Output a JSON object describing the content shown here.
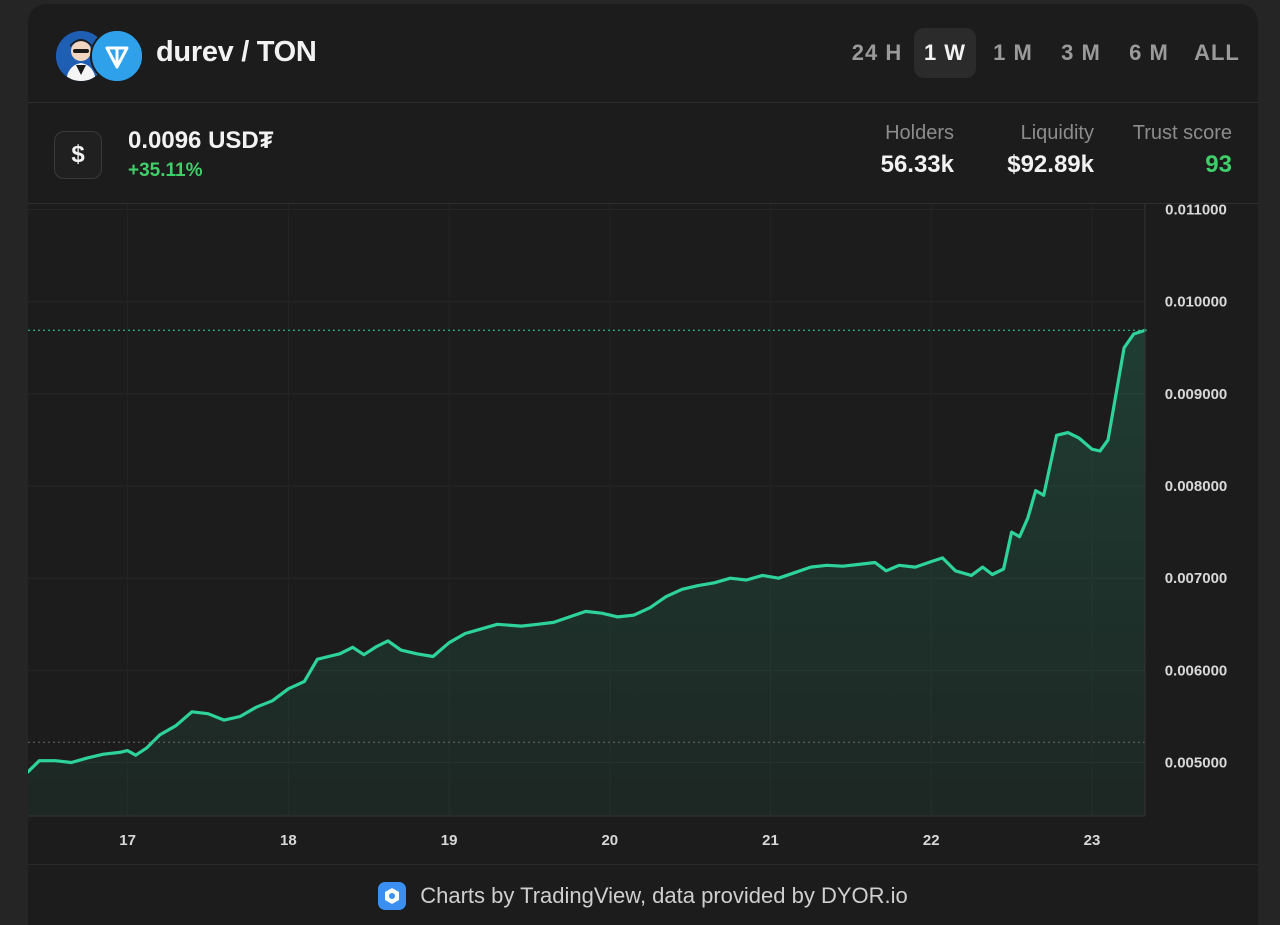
{
  "header": {
    "pair": "durev / TON",
    "ranges": [
      "24 H",
      "1 W",
      "1 M",
      "3 M",
      "6 M",
      "ALL"
    ],
    "active_range": "1 W",
    "token_icon": "durev-avatar-icon",
    "quote_icon": "ton-logo-icon"
  },
  "info": {
    "currency_icon": "dollar-icon",
    "currency_symbol": "$",
    "price": "0.0096 USD₮",
    "change": "+35.11%",
    "stats": [
      {
        "label": "Holders",
        "value": "56.33k"
      },
      {
        "label": "Liquidity",
        "value": "$92.89k"
      },
      {
        "label": "Trust score",
        "value": "93"
      }
    ]
  },
  "colors": {
    "line": "#2ed39a",
    "positive": "#3fcf6a",
    "background": "#1c1c1c"
  },
  "chart_data": {
    "type": "area",
    "y_ticks": [
      "0.011000",
      "0.010000",
      "0.009000",
      "0.008000",
      "0.007000",
      "0.006000",
      "0.005000"
    ],
    "x_ticks": [
      "17",
      "18",
      "19",
      "20",
      "21",
      "22",
      "23"
    ],
    "x_tick_values": [
      17,
      18,
      19,
      20,
      21,
      22,
      23
    ],
    "xlim": [
      16.38,
      23.33
    ],
    "ylim": [
      0.00442,
      0.01106
    ],
    "grid": true,
    "last_price_line": 0.00969,
    "reference_line": 0.00522,
    "series": [
      {
        "values": [
          [
            16.38,
            0.0049
          ],
          [
            16.45,
            0.00502
          ],
          [
            16.55,
            0.00502
          ],
          [
            16.65,
            0.005
          ],
          [
            16.75,
            0.00505
          ],
          [
            16.85,
            0.00509
          ],
          [
            16.95,
            0.00511
          ],
          [
            17.0,
            0.00513
          ],
          [
            17.05,
            0.00508
          ],
          [
            17.12,
            0.00516
          ],
          [
            17.2,
            0.0053
          ],
          [
            17.3,
            0.0054
          ],
          [
            17.4,
            0.00555
          ],
          [
            17.5,
            0.00553
          ],
          [
            17.6,
            0.00546
          ],
          [
            17.7,
            0.0055
          ],
          [
            17.8,
            0.0056
          ],
          [
            17.9,
            0.00567
          ],
          [
            18.0,
            0.0058
          ],
          [
            18.1,
            0.00588
          ],
          [
            18.18,
            0.00612
          ],
          [
            18.25,
            0.00615
          ],
          [
            18.32,
            0.00618
          ],
          [
            18.4,
            0.00625
          ],
          [
            18.47,
            0.00617
          ],
          [
            18.55,
            0.00626
          ],
          [
            18.62,
            0.00632
          ],
          [
            18.7,
            0.00622
          ],
          [
            18.8,
            0.00618
          ],
          [
            18.9,
            0.00615
          ],
          [
            19.0,
            0.0063
          ],
          [
            19.1,
            0.0064
          ],
          [
            19.2,
            0.00645
          ],
          [
            19.3,
            0.0065
          ],
          [
            19.45,
            0.00648
          ],
          [
            19.55,
            0.0065
          ],
          [
            19.65,
            0.00652
          ],
          [
            19.75,
            0.00658
          ],
          [
            19.85,
            0.00664
          ],
          [
            19.95,
            0.00662
          ],
          [
            20.05,
            0.00658
          ],
          [
            20.15,
            0.0066
          ],
          [
            20.25,
            0.00668
          ],
          [
            20.35,
            0.0068
          ],
          [
            20.45,
            0.00688
          ],
          [
            20.55,
            0.00692
          ],
          [
            20.65,
            0.00695
          ],
          [
            20.75,
            0.007
          ],
          [
            20.85,
            0.00698
          ],
          [
            20.95,
            0.00703
          ],
          [
            21.05,
            0.007
          ],
          [
            21.15,
            0.00706
          ],
          [
            21.25,
            0.00712
          ],
          [
            21.35,
            0.00714
          ],
          [
            21.45,
            0.00713
          ],
          [
            21.55,
            0.00715
          ],
          [
            21.65,
            0.00717
          ],
          [
            21.72,
            0.00708
          ],
          [
            21.8,
            0.00714
          ],
          [
            21.9,
            0.00712
          ],
          [
            22.0,
            0.00718
          ],
          [
            22.07,
            0.00722
          ],
          [
            22.15,
            0.00708
          ],
          [
            22.25,
            0.00703
          ],
          [
            22.32,
            0.00712
          ],
          [
            22.38,
            0.00704
          ],
          [
            22.45,
            0.0071
          ],
          [
            22.5,
            0.0075
          ],
          [
            22.55,
            0.00745
          ],
          [
            22.6,
            0.00765
          ],
          [
            22.65,
            0.00795
          ],
          [
            22.7,
            0.0079
          ],
          [
            22.78,
            0.00855
          ],
          [
            22.85,
            0.00858
          ],
          [
            22.92,
            0.00852
          ],
          [
            23.0,
            0.0084
          ],
          [
            23.05,
            0.00838
          ],
          [
            23.1,
            0.0085
          ],
          [
            23.2,
            0.0095
          ],
          [
            23.26,
            0.00965
          ],
          [
            23.33,
            0.00969
          ]
        ]
      }
    ]
  },
  "footer": {
    "credit": "Charts by TradingView, data provided by DYOR.io",
    "icon": "tradingview-hexagon-icon"
  }
}
